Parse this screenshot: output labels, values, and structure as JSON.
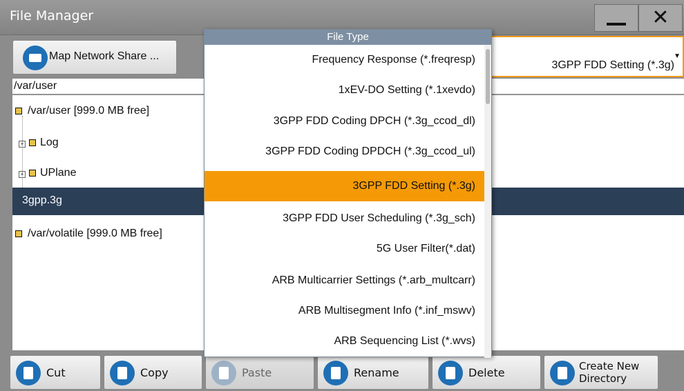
{
  "window": {
    "title": "File Manager"
  },
  "toolbar": {
    "map_network_share_label": "Map Network Share ...",
    "file_type_selected": "3GPP FDD Setting (*.3g)"
  },
  "path": "/var/user",
  "tree": {
    "rows": [
      {
        "label": "/var/user  [999.0 MB free]"
      },
      {
        "label": "Log"
      },
      {
        "label": "UPlane"
      },
      {
        "label": "3gpp.3g"
      },
      {
        "label": "/var/volatile  [999.0 MB free]"
      }
    ]
  },
  "popup": {
    "header": "File Type",
    "options": [
      {
        "label": "Frequency Response (*.freqresp)"
      },
      {
        "label": "1xEV-DO Setting (*.1xevdo)"
      },
      {
        "label": "3GPP FDD Coding DPCH (*.3g_ccod_dl)"
      },
      {
        "label": "3GPP FDD Coding DPDCH (*.3g_ccod_ul)"
      },
      {
        "label": "3GPP FDD Setting (*.3g)"
      },
      {
        "label": "3GPP FDD User Scheduling (*.3g_sch)"
      },
      {
        "label": "5G User Filter(*.dat)"
      },
      {
        "label": "ARB Multicarrier Settings (*.arb_multcarr)"
      },
      {
        "label": "ARB Multisegment Info (*.inf_mswv)"
      },
      {
        "label": "ARB Sequencing List (*.wvs)"
      }
    ],
    "selected_index": 4
  },
  "buttons": {
    "cut": "Cut",
    "copy": "Copy",
    "paste": "Paste",
    "rename": "Rename",
    "delete": "Delete",
    "create_line1": "Create New",
    "create_line2": "Directory"
  },
  "colors": {
    "accent_orange": "#f59a06",
    "selection_dark": "#2b3f57",
    "icon_blue": "#1f6fb5"
  }
}
